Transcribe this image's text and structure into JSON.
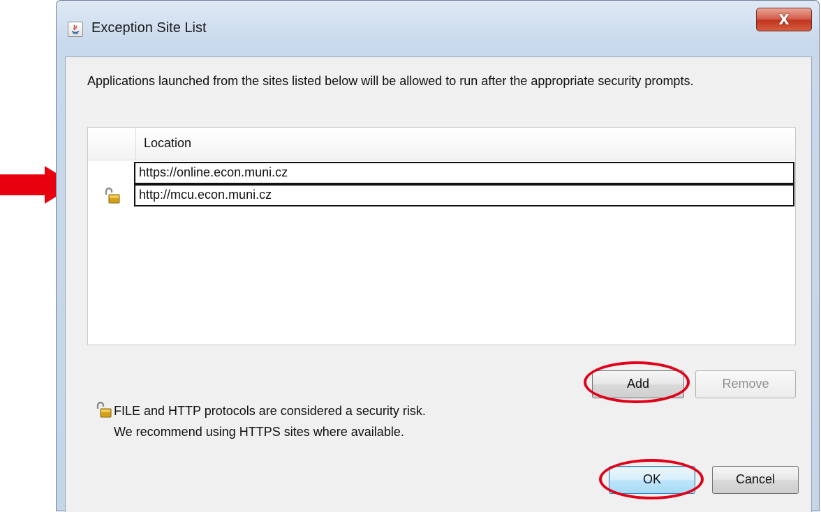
{
  "window": {
    "title": "Exception Site List",
    "close_symbol": "X"
  },
  "description": "Applications launched from the sites listed below will be allowed to run after the appropriate security prompts.",
  "table": {
    "column_header": "Location",
    "rows": [
      {
        "url": "https://online.econ.muni.cz",
        "icon": "none"
      },
      {
        "url": "http://mcu.econ.muni.cz",
        "icon": "unlocked-padlock-icon"
      }
    ]
  },
  "buttons": {
    "add": "Add",
    "remove": "Remove",
    "ok": "OK",
    "cancel": "Cancel"
  },
  "security_note": {
    "line1": "FILE and HTTP protocols are considered a security risk.",
    "line2": "We recommend using HTTPS sites where available."
  },
  "annotations": {
    "arrow_color": "#e8000f",
    "ellipse_color": "#e0001a"
  }
}
